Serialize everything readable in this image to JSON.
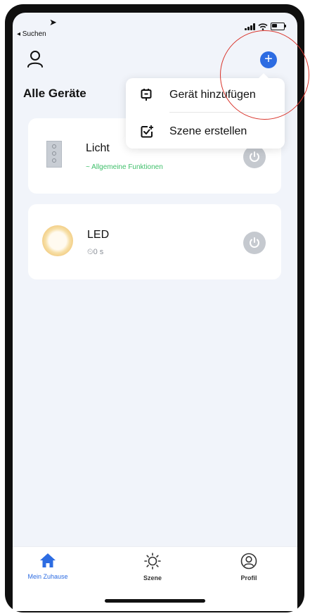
{
  "status_bar": {
    "back_label": "◂ Suchen"
  },
  "header": {
    "title": "Alle Geräte"
  },
  "devices": [
    {
      "name": "Licht",
      "subtitle": "~ Allgemeine Funktionen",
      "subtitle_color": "#3fbf6a"
    },
    {
      "name": "LED",
      "subtitle": "⏲0 s",
      "subtitle_color": "#8a8f97"
    }
  ],
  "add_menu": {
    "items": [
      {
        "label": "Gerät hinzufügen",
        "icon": "add-device-icon"
      },
      {
        "label": "Szene erstellen",
        "icon": "create-scene-icon"
      }
    ]
  },
  "tabs": [
    {
      "label": "Mein Zuhause",
      "icon": "home-icon",
      "active": true
    },
    {
      "label": "Szene",
      "icon": "sun-icon",
      "active": false
    },
    {
      "label": "Profil",
      "icon": "profile-icon",
      "active": false
    }
  ],
  "colors": {
    "accent": "#2d6ce2",
    "annotation": "#d9342b",
    "power_button": "#c5c9cf"
  }
}
